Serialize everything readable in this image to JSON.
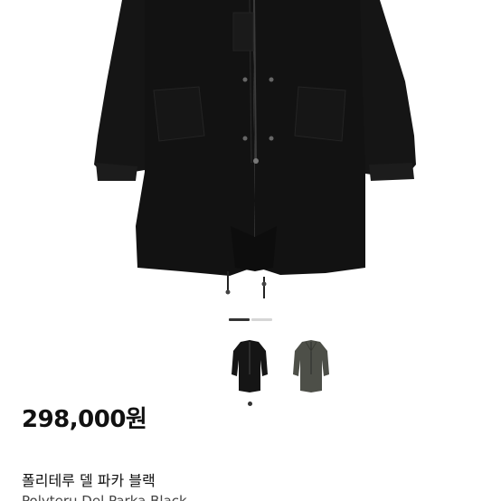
{
  "product": {
    "price": "298,000원",
    "name": "폴리테루 델 파카 블랙",
    "subtitle": "Polyteru Del Parka Black"
  },
  "gallery": {
    "current_index": 1,
    "total": 2,
    "variants": [
      {
        "color_name": "black",
        "color": "#151515",
        "selected": true
      },
      {
        "color_name": "olive-gray",
        "color": "#4d4f48",
        "selected": false
      }
    ]
  },
  "colors": {
    "coat": "#111111",
    "pager_active": "#333333",
    "pager_inactive": "#d6d6d6"
  }
}
